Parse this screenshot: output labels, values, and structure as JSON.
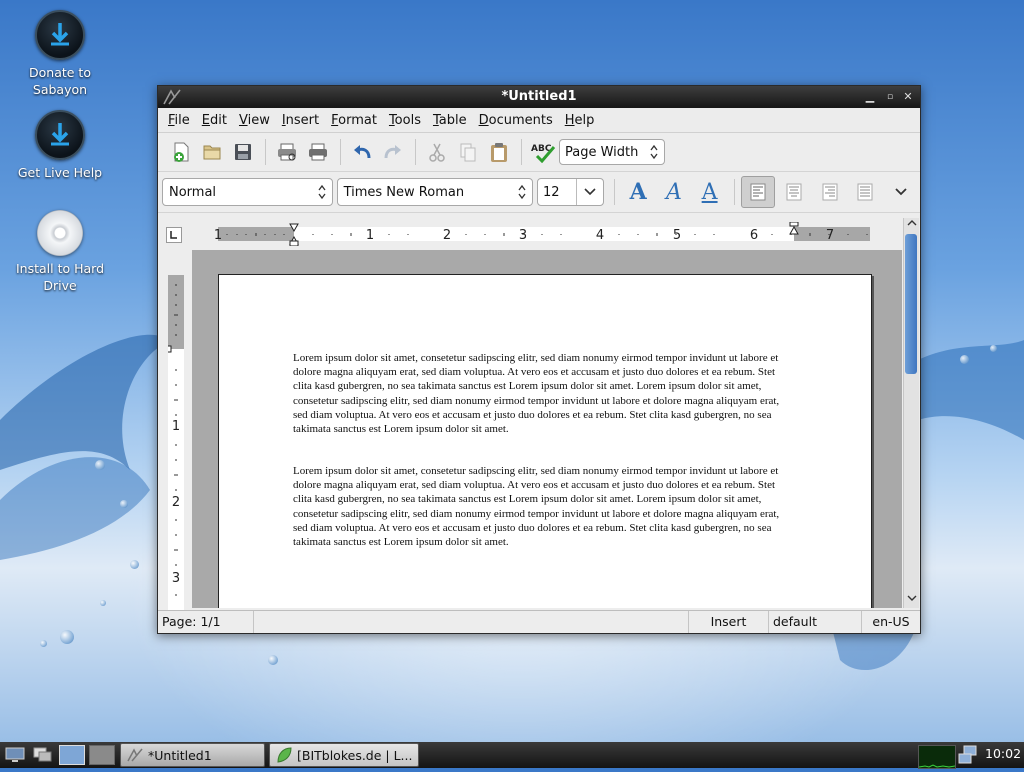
{
  "desktop": {
    "icons": [
      {
        "label": "Donate to Sabayon"
      },
      {
        "label": "Get Live Help"
      },
      {
        "label": "Install to Hard Drive"
      }
    ]
  },
  "window": {
    "title": "*Untitled1",
    "menu": [
      "File",
      "Edit",
      "View",
      "Insert",
      "Format",
      "Tools",
      "Table",
      "Documents",
      "Help"
    ],
    "toolbar": {
      "zoom_value": "Page Width",
      "buttons": [
        "new-document",
        "open",
        "save",
        "print-preview",
        "print",
        "undo",
        "redo",
        "cut",
        "copy",
        "paste",
        "spell-check"
      ]
    },
    "format": {
      "style": "Normal",
      "font": "Times New Roman",
      "size": "12",
      "alignment": "left"
    },
    "ruler": {
      "h_labels": [
        "1",
        "1",
        "2",
        "3",
        "4",
        "5",
        "6",
        "7"
      ],
      "v_labels": [
        "1",
        "2",
        "3"
      ]
    },
    "document": {
      "paragraphs": [
        "Lorem ipsum dolor sit amet, consetetur sadipscing elitr, sed diam nonumy eirmod tempor invidunt ut labore et dolore magna aliquyam erat, sed diam voluptua. At vero eos et accusam et justo duo dolores et ea rebum. Stet clita kasd gubergren, no sea takimata sanctus est Lorem ipsum dolor sit amet. Lorem ipsum dolor sit amet, consetetur sadipscing elitr, sed diam nonumy eirmod tempor invidunt ut labore et dolore magna aliquyam erat, sed diam voluptua. At vero eos et accusam et justo duo dolores et ea rebum. Stet clita kasd gubergren, no sea takimata sanctus est Lorem ipsum dolor sit amet.",
        "Lorem ipsum dolor sit amet, consetetur sadipscing elitr, sed diam nonumy eirmod tempor invidunt ut labore et dolore magna aliquyam erat, sed diam voluptua. At vero eos et accusam et justo duo dolores et ea rebum. Stet clita kasd gubergren, no sea takimata sanctus est Lorem ipsum dolor sit amet. Lorem ipsum dolor sit amet, consetetur sadipscing elitr, sed diam nonumy eirmod tempor invidunt ut labore et dolore magna aliquyam erat, sed diam voluptua. At vero eos et accusam et justo duo dolores et ea rebum. Stet clita kasd gubergren, no sea takimata sanctus est Lorem ipsum dolor sit amet."
      ]
    },
    "status": {
      "page": "Page: 1/1",
      "mode": "Insert",
      "style": "default",
      "language": "en-US"
    }
  },
  "taskbar": {
    "tasks": [
      {
        "label": "*Untitled1"
      },
      {
        "label": "[BITblokes.de | L..."
      }
    ],
    "clock": "10:02"
  }
}
